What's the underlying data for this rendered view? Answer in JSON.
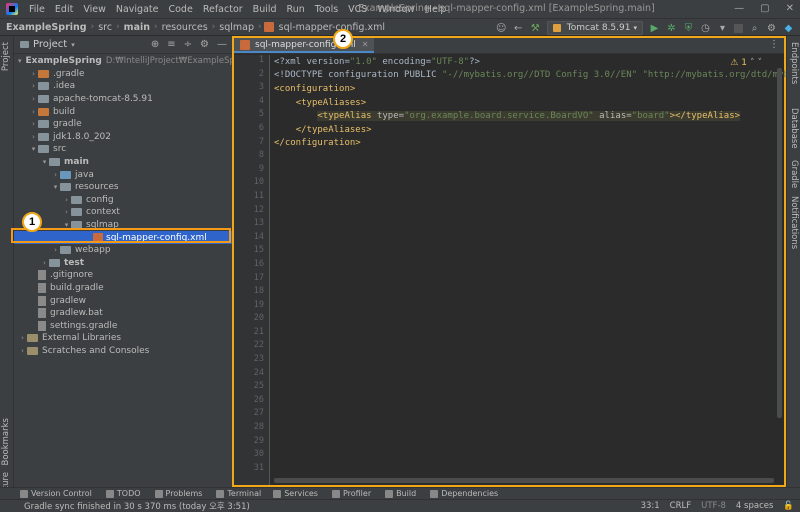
{
  "menubar": {
    "items": [
      "File",
      "Edit",
      "View",
      "Navigate",
      "Code",
      "Refactor",
      "Build",
      "Run",
      "Tools",
      "VCS",
      "Window",
      "Help"
    ],
    "window_title": "ExampleSpring - sql-mapper-config.xml [ExampleSpring.main]",
    "controls": [
      "—",
      "▢",
      "✕"
    ]
  },
  "navbar": {
    "breadcrumbs": [
      "ExampleSpring",
      "src",
      "main",
      "resources",
      "sqlmap",
      "sql-mapper-config.xml"
    ],
    "run_config": "Tomcat 8.5.91"
  },
  "project_panel": {
    "title": "Project",
    "tree": [
      {
        "label": "ExampleSpring",
        "path": "D:₩IntelliJProject₩ExampleSpring",
        "indent": 0,
        "arrow": "▾",
        "icon": "folder-blue",
        "bold": true
      },
      {
        "label": ".gradle",
        "indent": 1,
        "arrow": "›",
        "icon": "folder-orange"
      },
      {
        "label": ".idea",
        "indent": 1,
        "arrow": "›",
        "icon": "folder"
      },
      {
        "label": "apache-tomcat-8.5.91",
        "indent": 1,
        "arrow": "›",
        "icon": "folder"
      },
      {
        "label": "build",
        "indent": 1,
        "arrow": "›",
        "icon": "folder-orange"
      },
      {
        "label": "gradle",
        "indent": 1,
        "arrow": "›",
        "icon": "folder"
      },
      {
        "label": "jdk1.8.0_202",
        "indent": 1,
        "arrow": "›",
        "icon": "folder"
      },
      {
        "label": "src",
        "indent": 1,
        "arrow": "▾",
        "icon": "folder"
      },
      {
        "label": "main",
        "indent": 2,
        "arrow": "▾",
        "icon": "folder",
        "bold": true
      },
      {
        "label": "java",
        "indent": 3,
        "arrow": "›",
        "icon": "folder-blue"
      },
      {
        "label": "resources",
        "indent": 3,
        "arrow": "▾",
        "icon": "folder"
      },
      {
        "label": "config",
        "indent": 4,
        "arrow": "›",
        "icon": "folder"
      },
      {
        "label": "context",
        "indent": 4,
        "arrow": "›",
        "icon": "folder"
      },
      {
        "label": "sqlmap",
        "indent": 4,
        "arrow": "▾",
        "icon": "folder"
      },
      {
        "label": "sql-mapper-config.xml",
        "indent": 6,
        "arrow": "",
        "icon": "xml",
        "selected": true
      },
      {
        "label": "webapp",
        "indent": 3,
        "arrow": "›",
        "icon": "folder"
      },
      {
        "label": "test",
        "indent": 2,
        "arrow": "›",
        "icon": "folder",
        "bold": true
      },
      {
        "label": ".gitignore",
        "indent": 1,
        "arrow": "",
        "icon": "file"
      },
      {
        "label": "build.gradle",
        "indent": 1,
        "arrow": "",
        "icon": "file"
      },
      {
        "label": "gradlew",
        "indent": 1,
        "arrow": "",
        "icon": "file"
      },
      {
        "label": "gradlew.bat",
        "indent": 1,
        "arrow": "",
        "icon": "file"
      },
      {
        "label": "settings.gradle",
        "indent": 1,
        "arrow": "",
        "icon": "file"
      },
      {
        "label": "External Libraries",
        "indent": 0,
        "arrow": "›",
        "icon": "lib"
      },
      {
        "label": "Scratches and Consoles",
        "indent": 0,
        "arrow": "›",
        "icon": "lib"
      }
    ]
  },
  "left_strip": {
    "tabs": [
      "Project",
      "Bookmarks",
      "Structure"
    ]
  },
  "right_strip": {
    "tabs": [
      "Endpoints",
      "Database",
      "Gradle",
      "Notifications"
    ]
  },
  "editor": {
    "tab_label": "sql-mapper-config.xml",
    "warning_count": "1",
    "line_numbers": [
      "1",
      "2",
      "3",
      "4",
      "5",
      "6",
      "7",
      "8",
      "9",
      "10",
      "11",
      "12",
      "13",
      "14",
      "15",
      "16",
      "17",
      "18",
      "19",
      "20",
      "21",
      "22",
      "23",
      "24",
      "25",
      "26",
      "27",
      "28",
      "29",
      "30",
      "31"
    ],
    "code_lines": [
      [
        {
          "t": "punct",
          "v": "<?xml version="
        },
        {
          "t": "str",
          "v": "\"1.0\""
        },
        {
          "t": "punct",
          "v": " encoding="
        },
        {
          "t": "str",
          "v": "\"UTF-8\""
        },
        {
          "t": "punct",
          "v": "?>"
        }
      ],
      [
        {
          "t": "punct",
          "v": "<!DOCTYPE configuration PUBLIC "
        },
        {
          "t": "str",
          "v": "\"-//mybatis.org//DTD Config 3.0//EN\""
        },
        {
          "t": "punct",
          "v": " "
        },
        {
          "t": "str",
          "v": "\"http://mybatis.org/dtd/mybatis-3-"
        }
      ],
      [
        {
          "t": "tag",
          "v": "<configuration>"
        }
      ],
      [
        {
          "t": "punct",
          "v": "    "
        },
        {
          "t": "tag",
          "v": "<typeAliases>"
        }
      ],
      [
        {
          "t": "punct",
          "v": "        "
        },
        {
          "t": "tag",
          "v": "<typeAlias "
        },
        {
          "t": "attr",
          "v": "type="
        },
        {
          "t": "str",
          "v": "\"org.example.board.service.BoardVO\""
        },
        {
          "t": "punct",
          "v": " "
        },
        {
          "t": "attr",
          "v": "alias="
        },
        {
          "t": "str",
          "v": "\"board\""
        },
        {
          "t": "tag",
          "v": "></typeAlias>"
        }
      ],
      [
        {
          "t": "punct",
          "v": "    "
        },
        {
          "t": "tag",
          "v": "</typeAliases>"
        }
      ],
      [
        {
          "t": "tag",
          "v": "</configuration>"
        }
      ]
    ],
    "highlight_line": 5
  },
  "callouts": [
    "1",
    "2"
  ],
  "tool_windows": [
    "Version Control",
    "TODO",
    "Problems",
    "Terminal",
    "Services",
    "Profiler",
    "Build",
    "Dependencies"
  ],
  "status": {
    "message": "Gradle sync finished in 30 s 370 ms (today 오후 3:51)",
    "position": "33:1",
    "line_sep": "CRLF",
    "encoding": "UTF-8",
    "indent": "4 spaces"
  }
}
